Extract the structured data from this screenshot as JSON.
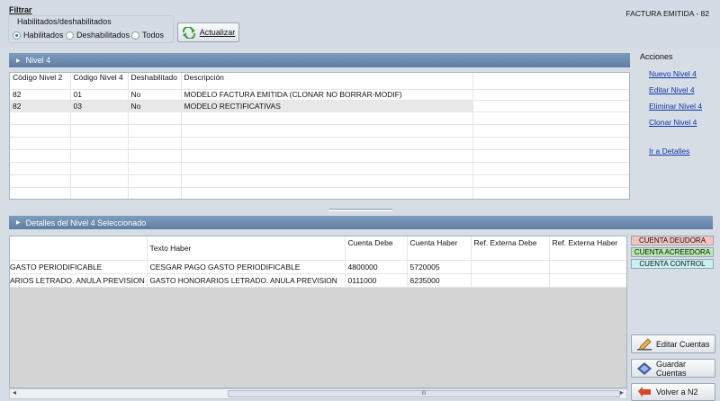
{
  "filter": {
    "title": "Filtrar",
    "group_label": "Habilitados/deshabilitados",
    "options": [
      {
        "label": "Habilitados",
        "selected": true
      },
      {
        "label": "Deshabilitados",
        "selected": false
      },
      {
        "label": "Todos",
        "selected": false
      }
    ],
    "update_button": "Actualizar"
  },
  "page_heading": "FACTURA EMITIDA - 82",
  "nivel4": {
    "title": "Nivel 4",
    "columns": [
      "Código Nivel 2",
      "Código Nivel 4",
      "Deshabilitado",
      "Descripción"
    ],
    "rows": [
      [
        "82",
        "01",
        "No",
        "MODELO FACTURA EMITIDA (CLONAR NO BORRAR-MODIF)"
      ],
      [
        "82",
        "03",
        "No",
        "MODELO RECTIFICATIVAS"
      ]
    ]
  },
  "actions": {
    "title": "Acciones",
    "links": [
      "Nuevo Nivel 4",
      "Editar Nivel 4",
      "Eliminar Nivel 4",
      "Clonar Nivel 4",
      "Ir a Detalles"
    ]
  },
  "detalles": {
    "title": "Detalles del Nivel 4 Seleccionado",
    "columns": [
      "",
      "Texto Haber",
      "Cuenta Debe",
      "Cuenta Haber",
      "Ref. Externa Debe",
      "Ref. Externa Haber"
    ],
    "rows": [
      [
        "GASTO PERIODIFICABLE",
        "CESGAR PAGO GASTO PERIODIFICABLE",
        "4800000",
        "5720005",
        "",
        ""
      ],
      [
        "ARIOS LETRADO. ANULA PREVISION",
        "GASTO HONORARIOS LETRADO. ANULA PREVISION",
        "0111000",
        "6235000",
        "",
        ""
      ]
    ]
  },
  "legend": [
    {
      "label": "CUENTA DEUDORA",
      "color": "#f4c4c4"
    },
    {
      "label": "CUENTA ACREEDORA",
      "color": "#b9e7b0"
    },
    {
      "label": "CUENTA CONTROL",
      "color": "#c8f0f0"
    }
  ],
  "buttons": {
    "edit_accounts": "Editar Cuentas",
    "save_accounts": "Guardar Cuentas",
    "back": "Volver a N2"
  },
  "scrollbar": {
    "grip": "III"
  },
  "colors": {
    "panel_header": "#6f8db0",
    "link": "#1133aa",
    "background": "#d6dde5"
  }
}
